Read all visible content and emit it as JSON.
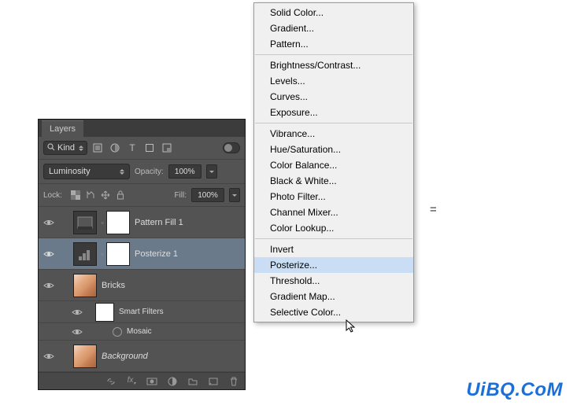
{
  "panel": {
    "title": "Layers",
    "filter": {
      "kind_label": "Kind"
    },
    "blend": {
      "mode": "Luminosity",
      "opacity_label": "Opacity:",
      "opacity_value": "100%"
    },
    "lock": {
      "label": "Lock:",
      "fill_label": "Fill:",
      "fill_value": "100%"
    },
    "layers": [
      {
        "name": "Pattern Fill 1"
      },
      {
        "name": "Posterize 1"
      },
      {
        "name": "Bricks"
      },
      {
        "name": "Smart Filters"
      },
      {
        "name": "Mosaic"
      },
      {
        "name": "Background"
      }
    ]
  },
  "menu": {
    "groups": [
      [
        "Solid Color...",
        "Gradient...",
        "Pattern..."
      ],
      [
        "Brightness/Contrast...",
        "Levels...",
        "Curves...",
        "Exposure..."
      ],
      [
        "Vibrance...",
        "Hue/Saturation...",
        "Color Balance...",
        "Black & White...",
        "Photo Filter...",
        "Channel Mixer...",
        "Color Lookup..."
      ],
      [
        "Invert",
        "Posterize...",
        "Threshold...",
        "Gradient Map...",
        "Selective Color..."
      ]
    ],
    "highlighted": "Posterize..."
  },
  "equals": "=",
  "watermark": "UiBQ.CoM"
}
